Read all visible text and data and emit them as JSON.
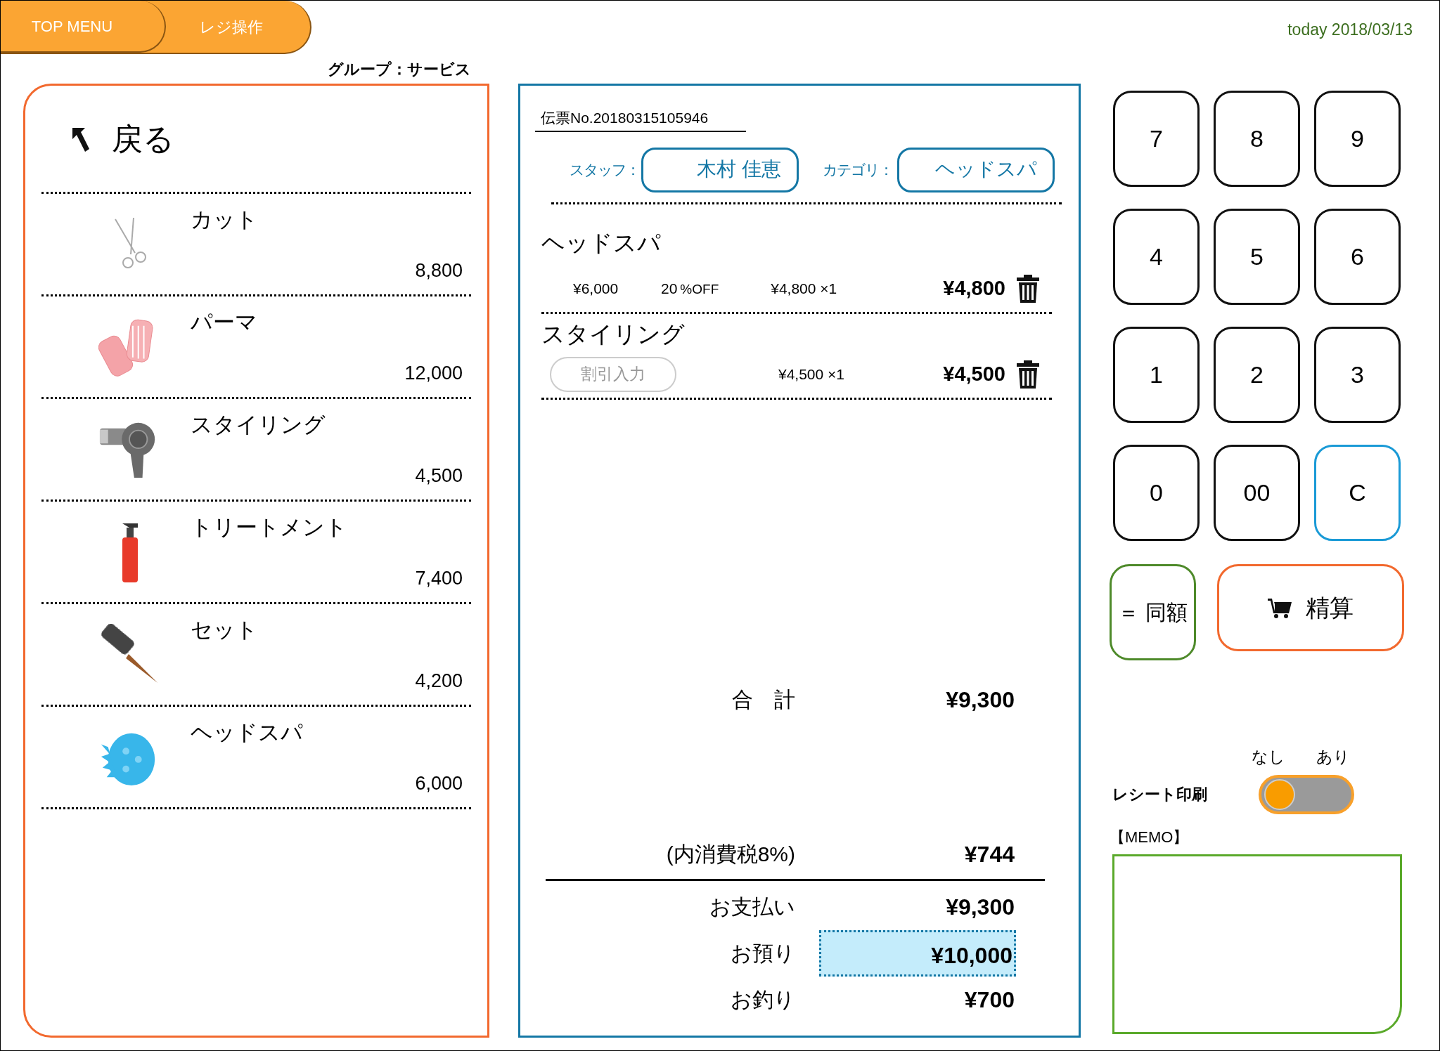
{
  "breadcrumb": [
    {
      "label": "TOP MENU"
    },
    {
      "label": "レジ操作"
    }
  ],
  "date": "today 2018/03/13",
  "group_label": "グループ：サービス",
  "menu": {
    "back": "戻る",
    "items": [
      {
        "kind": "scissors",
        "name": "カット",
        "price": "8,800"
      },
      {
        "kind": "rollers",
        "name": "パーマ",
        "price": "12,000"
      },
      {
        "kind": "dryer",
        "name": "スタイリング",
        "price": "4,500"
      },
      {
        "kind": "spray",
        "name": "トリートメント",
        "price": "7,400"
      },
      {
        "kind": "brush",
        "name": "セット",
        "price": "4,200"
      },
      {
        "kind": "scalp_brush",
        "name": "ヘッドスパ",
        "price": "6,000"
      }
    ]
  },
  "slip": {
    "number": "伝票No.20180315105946",
    "staff_label": "スタッフ：",
    "staff": "木村 佳恵",
    "category_label": "カテゴリ：",
    "category": "ヘッドスパ",
    "lines": [
      {
        "name": "ヘッドスパ",
        "list_price": "¥6,000",
        "discount": "20",
        "discount_unit": "%OFF",
        "unit_qty": "¥4,800 ×1",
        "amount": "¥4,800"
      },
      {
        "name": "スタイリング",
        "discount_button": "割引入力",
        "unit_qty": "¥4,500 ×1",
        "amount": "¥4,500"
      }
    ],
    "total": {
      "label": "合　計",
      "value": "¥9,300"
    },
    "tax": {
      "label": "(内消費税8%)",
      "value": "¥744"
    },
    "payments": [
      {
        "label": "お支払い",
        "value": "¥9,300",
        "selected": false
      },
      {
        "label": "お預り",
        "value": "¥10,000",
        "selected": true
      },
      {
        "label": "お釣り",
        "value": "¥700",
        "selected": false
      }
    ]
  },
  "keypad": [
    {
      "kind": "digit",
      "label": "7"
    },
    {
      "kind": "digit",
      "label": "8"
    },
    {
      "kind": "digit",
      "label": "9"
    },
    {
      "kind": "digit",
      "label": "4"
    },
    {
      "kind": "digit",
      "label": "5"
    },
    {
      "kind": "digit",
      "label": "6"
    },
    {
      "kind": "digit",
      "label": "1"
    },
    {
      "kind": "digit",
      "label": "2"
    },
    {
      "kind": "digit",
      "label": "3"
    },
    {
      "kind": "digit",
      "label": "0"
    },
    {
      "kind": "digit",
      "label": "00"
    },
    {
      "kind": "clear",
      "label": "C"
    }
  ],
  "same_amount_button": "＝ 同額",
  "checkout_button": "精算",
  "receipt_print": {
    "label": "レシート印刷",
    "off_label": "なし",
    "on_label": "あり",
    "on": false
  },
  "memo_label": "【MEMO】"
}
